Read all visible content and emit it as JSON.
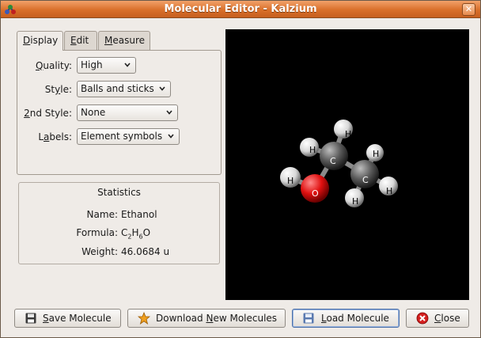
{
  "window": {
    "title": "Molecular Editor - Kalzium",
    "close_label": "✕"
  },
  "tabs": [
    {
      "pre": "",
      "mn": "D",
      "post": "isplay"
    },
    {
      "pre": "",
      "mn": "E",
      "post": "dit"
    },
    {
      "pre": "",
      "mn": "M",
      "post": "easure"
    }
  ],
  "display": {
    "quality": {
      "pre": "",
      "mn": "Q",
      "post": "uality:",
      "value": "High"
    },
    "style": {
      "pre": "St",
      "mn": "y",
      "post": "le:",
      "value": "Balls and sticks"
    },
    "second_style": {
      "pre": "",
      "mn": "2",
      "post": "nd Style:",
      "value": "None"
    },
    "labels": {
      "pre": "L",
      "mn": "a",
      "post": "bels:",
      "value": "Element symbols"
    }
  },
  "statistics": {
    "title": "Statistics",
    "name_label": "Name:",
    "name_value": "Ethanol",
    "formula_label": "Formula:",
    "formula_parts": [
      "C",
      "2",
      "H",
      "6",
      "O"
    ],
    "weight_label": "Weight:",
    "weight_value": "46.0684 u"
  },
  "atoms": {
    "oxygen": "O",
    "carbon": "C",
    "hydrogen": "H"
  },
  "buttons": {
    "save": {
      "pre": "",
      "mn": "S",
      "post": "ave Molecule"
    },
    "download": {
      "pre": "Download ",
      "mn": "N",
      "post": "ew Molecules"
    },
    "load": {
      "pre": "",
      "mn": "L",
      "post": "oad Molecule"
    },
    "close": {
      "pre": "",
      "mn": "C",
      "post": "lose"
    }
  },
  "colors": {
    "titlebar": "#d96f2a",
    "oxygen": "#e01010",
    "carbon": "#4a4a4a",
    "hydrogen": "#f0f0f0"
  }
}
